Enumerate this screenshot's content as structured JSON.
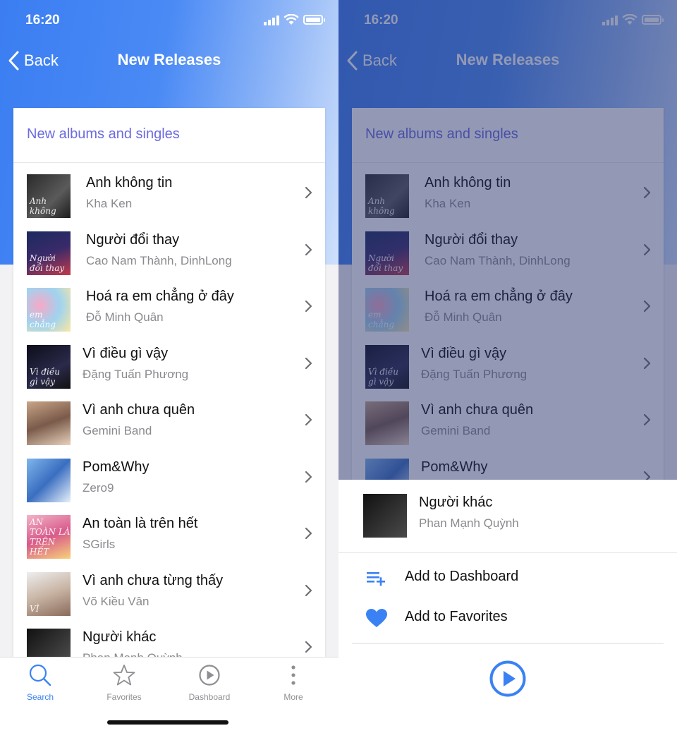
{
  "status": {
    "time": "16:20"
  },
  "nav": {
    "back_label": "Back",
    "title": "New Releases"
  },
  "section_header": "New albums and singles",
  "colors": {
    "accent": "#3a82f3",
    "header_purple": "#6b6be0",
    "hero_start": "#3b7ef2",
    "hero_end": "#cfe0fb"
  },
  "releases": [
    {
      "title": "Anh không tin",
      "artist": "Kha Ken",
      "cover_text": "Anh không"
    },
    {
      "title": "Người đổi thay",
      "artist": "Cao Nam Thành, DinhLong",
      "cover_text": "Người đổi thay"
    },
    {
      "title": "Hoá ra em chẳng ở đây",
      "artist": "Đỗ Minh Quân",
      "cover_text": "em chẳng"
    },
    {
      "title": "Vì điều gì vậy",
      "artist": "Đặng Tuấn Phương",
      "cover_text": "Vì điều gì vậy"
    },
    {
      "title": "Vì anh chưa quên",
      "artist": "Gemini Band",
      "cover_text": ""
    },
    {
      "title": "Pom&Why",
      "artist": "Zero9",
      "cover_text": ""
    },
    {
      "title": "An toàn là trên hết",
      "artist": "SGirls",
      "cover_text": "AN TOÀN LÀ TRÊN HẾT"
    },
    {
      "title": "Vì anh chưa từng thấy",
      "artist": "Võ Kiều Vân",
      "cover_text": "VÌ"
    },
    {
      "title": "Người khác",
      "artist": "Phan Mạnh Quỳnh",
      "cover_text": ""
    }
  ],
  "tabs": [
    {
      "label": "Search",
      "icon": "search-icon",
      "active": true
    },
    {
      "label": "Favorites",
      "icon": "star-icon",
      "active": false
    },
    {
      "label": "Dashboard",
      "icon": "play-circle-icon",
      "active": false
    },
    {
      "label": "More",
      "icon": "more-vertical-icon",
      "active": false
    }
  ],
  "action_sheet": {
    "item": {
      "title": "Người khác",
      "artist": "Phan Mạnh Quỳnh"
    },
    "actions": [
      {
        "label": "Add to Dashboard",
        "icon": "playlist-add-icon"
      },
      {
        "label": "Add to Favorites",
        "icon": "heart-icon"
      }
    ],
    "play_icon": "play-circle-icon"
  }
}
